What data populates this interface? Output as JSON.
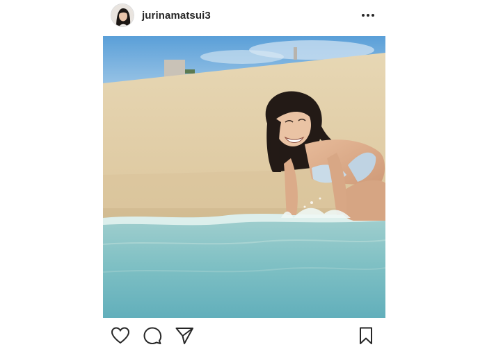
{
  "post": {
    "username": "jurinamatsui3"
  },
  "icons": {
    "avatar": "profile-avatar",
    "more": "more-options-icon",
    "like": "heart-icon",
    "comment": "comment-bubble-icon",
    "share": "paper-plane-icon",
    "save": "bookmark-icon"
  },
  "colors": {
    "text": "#262626",
    "icon": "#262626",
    "background": "#ffffff"
  }
}
